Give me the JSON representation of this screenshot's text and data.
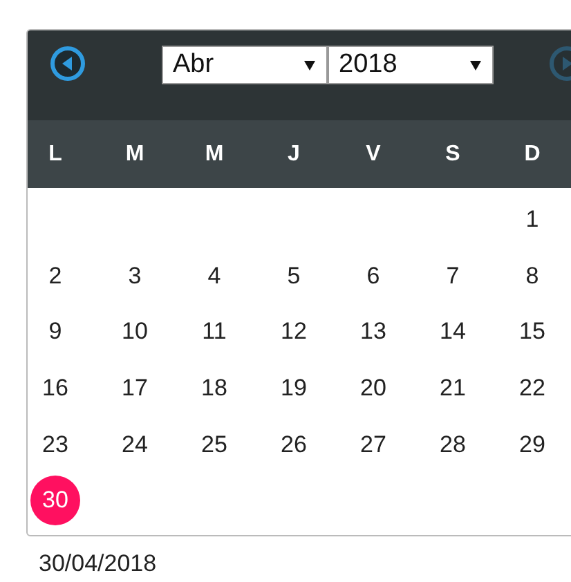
{
  "calendar": {
    "prev_disabled": false,
    "next_disabled": true,
    "month": "Abr",
    "year": "2018",
    "weekdays": [
      "L",
      "M",
      "M",
      "J",
      "V",
      "S",
      "D"
    ],
    "weeks": [
      {
        "kind": "first",
        "days": [
          {
            "label": "1",
            "selected": false
          }
        ]
      },
      {
        "kind": "full",
        "days": [
          {
            "label": "2",
            "selected": false
          },
          {
            "label": "3",
            "selected": false
          },
          {
            "label": "4",
            "selected": false
          },
          {
            "label": "5",
            "selected": false
          },
          {
            "label": "6",
            "selected": false
          },
          {
            "label": "7",
            "selected": false
          },
          {
            "label": "8",
            "selected": false
          }
        ]
      },
      {
        "kind": "full",
        "days": [
          {
            "label": "9",
            "selected": false
          },
          {
            "label": "10",
            "selected": false
          },
          {
            "label": "11",
            "selected": false
          },
          {
            "label": "12",
            "selected": false
          },
          {
            "label": "13",
            "selected": false
          },
          {
            "label": "14",
            "selected": false
          },
          {
            "label": "15",
            "selected": false
          }
        ]
      },
      {
        "kind": "full",
        "days": [
          {
            "label": "16",
            "selected": false
          },
          {
            "label": "17",
            "selected": false
          },
          {
            "label": "18",
            "selected": false
          },
          {
            "label": "19",
            "selected": false
          },
          {
            "label": "20",
            "selected": false
          },
          {
            "label": "21",
            "selected": false
          },
          {
            "label": "22",
            "selected": false
          }
        ]
      },
      {
        "kind": "full",
        "days": [
          {
            "label": "23",
            "selected": false
          },
          {
            "label": "24",
            "selected": false
          },
          {
            "label": "25",
            "selected": false
          },
          {
            "label": "26",
            "selected": false
          },
          {
            "label": "27",
            "selected": false
          },
          {
            "label": "28",
            "selected": false
          },
          {
            "label": "29",
            "selected": false
          }
        ]
      },
      {
        "kind": "last",
        "days": [
          {
            "label": "30",
            "selected": true
          }
        ]
      }
    ]
  },
  "date_field": {
    "value": "30/04/2018"
  }
}
